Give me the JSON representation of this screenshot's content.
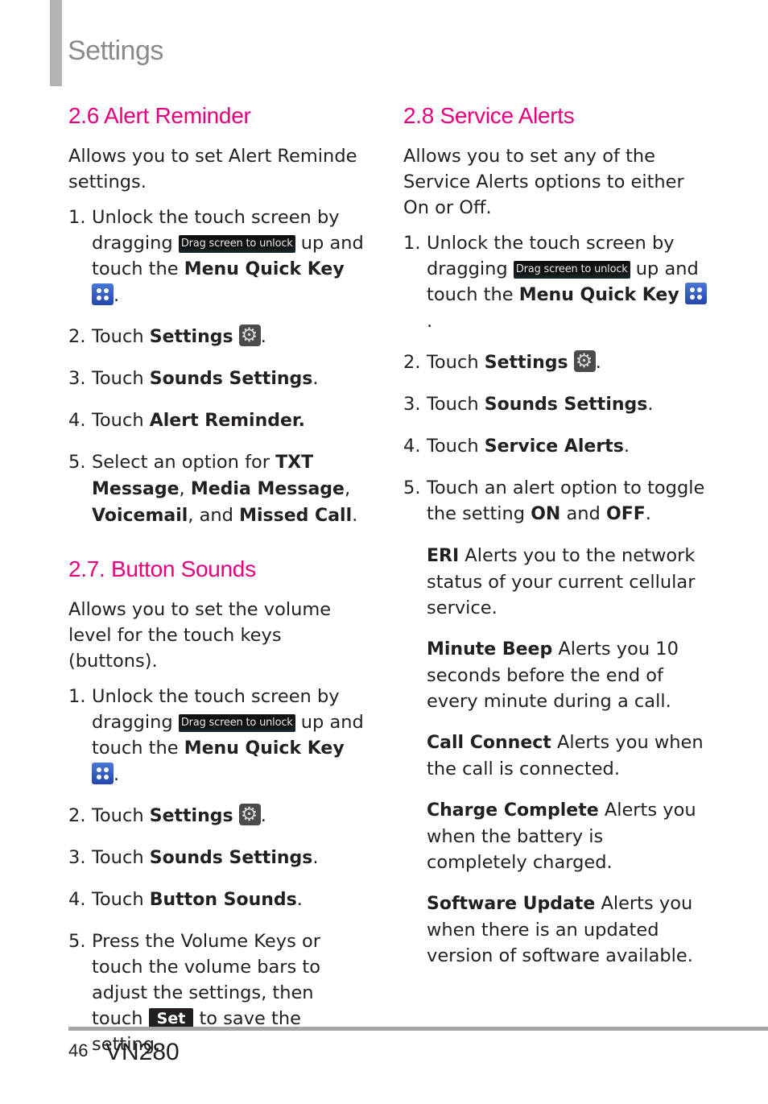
{
  "header": {
    "title": "Settings"
  },
  "drag_chip_label": "Drag screen to unlock",
  "set_chip_label": "Set",
  "left_column": {
    "section1": {
      "title": "2.6 Alert Reminder",
      "intro": "Allows you to set Alert Reminde settings.",
      "steps": [
        {
          "num": "1.",
          "a": "Unlock the touch screen by dragging ",
          "b": " up and touch the ",
          "bold": "Menu Quick Key",
          "c": "."
        },
        {
          "num": "2.",
          "a": "Touch ",
          "bold": "Settings",
          "c": "."
        },
        {
          "num": "3.",
          "a": "Touch ",
          "bold": "Sounds Settings",
          "c": "."
        },
        {
          "num": "4.",
          "a": "Touch ",
          "bold": "Alert Reminder.",
          "c": ""
        },
        {
          "num": "5.",
          "a": "Select an option for ",
          "bold1": "TXT Message",
          "s1": ", ",
          "bold2": "Media Message",
          "s2": ", ",
          "bold3": "Voicemail",
          "s3": ", and ",
          "bold4": "Missed Call",
          "c": "."
        }
      ]
    },
    "section2": {
      "title": "2.7. Button Sounds",
      "intro": "Allows you to set the volume level for the touch keys (buttons).",
      "steps": [
        {
          "num": "1.",
          "a": "Unlock the touch screen by dragging ",
          "b": " up and touch the ",
          "bold": "Menu Quick Key",
          "c": "."
        },
        {
          "num": "2.",
          "a": "Touch ",
          "bold": "Settings",
          "c": "."
        },
        {
          "num": "3.",
          "a": "Touch ",
          "bold": "Sounds Settings",
          "c": "."
        },
        {
          "num": "4.",
          "a": "Touch ",
          "bold": "Button Sounds",
          "c": "."
        },
        {
          "num": "5.",
          "a": "Press the Volume Keys or touch the volume bars to adjust the settings, then touch ",
          "c": " to save the setting."
        }
      ]
    }
  },
  "right_column": {
    "title": "2.8 Service Alerts",
    "intro": "Allows you to set any of the Service Alerts options to either On or Off.",
    "steps": [
      {
        "num": "1.",
        "a": "Unlock the touch screen by dragging ",
        "b": " up and touch the ",
        "bold": "Menu Quick Key",
        "c": "."
      },
      {
        "num": "2.",
        "a": "Touch ",
        "bold": "Settings",
        "c": "."
      },
      {
        "num": "3.",
        "a": "Touch ",
        "bold": "Sounds Settings",
        "c": "."
      },
      {
        "num": "4.",
        "a": "Touch ",
        "bold": "Service Alerts",
        "c": "."
      },
      {
        "num": "5.",
        "a": "Touch an alert option to toggle the setting ",
        "bold1": "ON",
        "s1": " and ",
        "bold2": "OFF",
        "c": "."
      }
    ],
    "options": [
      {
        "name": "ERI",
        "desc": " Alerts you to the network status of your current cellular service."
      },
      {
        "name": "Minute Beep",
        "desc": " Alerts you 10 seconds before the end of every minute during a call."
      },
      {
        "name": "Call Connect",
        "desc": " Alerts you when the call is connected."
      },
      {
        "name": "Charge Complete",
        "desc": " Alerts you when the battery is completely charged."
      },
      {
        "name": "Software Update",
        "desc": " Alerts you when there is an updated version of software available."
      }
    ]
  },
  "footer": {
    "page_number": "46",
    "model": "VN280"
  }
}
